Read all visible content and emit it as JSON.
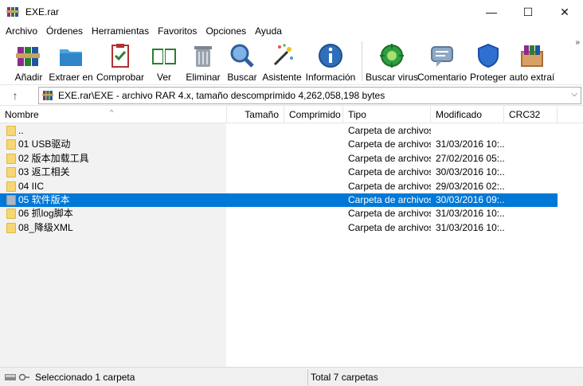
{
  "window": {
    "title": "EXE.rar",
    "minimize": "—",
    "maximize": "☐",
    "close": "✕"
  },
  "menu": [
    "Archivo",
    "Órdenes",
    "Herramientas",
    "Favoritos",
    "Opciones",
    "Ayuda"
  ],
  "toolbar": [
    {
      "label": "Añadir",
      "icon": "books-add-icon"
    },
    {
      "label": "Extraer en",
      "icon": "folder-extract-icon"
    },
    {
      "label": "Comprobar",
      "icon": "clipboard-check-icon"
    },
    {
      "label": "Ver",
      "icon": "open-book-icon"
    },
    {
      "label": "Eliminar",
      "icon": "trash-icon"
    },
    {
      "label": "Buscar",
      "icon": "magnifier-icon"
    },
    {
      "label": "Asistente",
      "icon": "wand-icon"
    },
    {
      "label": "Información",
      "icon": "info-icon"
    },
    {
      "label": "Buscar virus",
      "icon": "virus-icon"
    },
    {
      "label": "Comentario",
      "icon": "comment-icon"
    },
    {
      "label": "Proteger",
      "icon": "shield-icon"
    },
    {
      "label": "auto extraí",
      "icon": "sfx-box-icon"
    }
  ],
  "toolbar_overflow": "»",
  "address": {
    "text": "EXE.rar\\EXE - archivo RAR 4.x, tamaño descomprimido 4,262,058,198 bytes",
    "up": "↑",
    "dropdown": "⌵"
  },
  "columns": [
    "Nombre",
    "Tamaño",
    "Comprimido",
    "Tipo",
    "Modificado",
    "CRC32"
  ],
  "rows": [
    {
      "name": "..",
      "size": "",
      "packed": "",
      "type": "Carpeta de archivos",
      "modified": "",
      "crc": ""
    },
    {
      "name": "01 USB驱动",
      "size": "",
      "packed": "",
      "type": "Carpeta de archivos",
      "modified": "31/03/2016 10:...",
      "crc": ""
    },
    {
      "name": "02 版本加载工具",
      "size": "",
      "packed": "",
      "type": "Carpeta de archivos",
      "modified": "27/02/2016 05:...",
      "crc": ""
    },
    {
      "name": "03 返工相关",
      "size": "",
      "packed": "",
      "type": "Carpeta de archivos",
      "modified": "30/03/2016 10:...",
      "crc": ""
    },
    {
      "name": "04 IIC",
      "size": "",
      "packed": "",
      "type": "Carpeta de archivos",
      "modified": "29/03/2016 02:...",
      "crc": ""
    },
    {
      "name": "05 软件版本",
      "size": "",
      "packed": "",
      "type": "Carpeta de archivos",
      "modified": "30/03/2016 09:...",
      "crc": "",
      "selected": true
    },
    {
      "name": "06 抓log脚本",
      "size": "",
      "packed": "",
      "type": "Carpeta de archivos",
      "modified": "31/03/2016 10:...",
      "crc": ""
    },
    {
      "name": "08_降级XML",
      "size": "",
      "packed": "",
      "type": "Carpeta de archivos",
      "modified": "31/03/2016 10:...",
      "crc": ""
    }
  ],
  "status": {
    "left": "Seleccionado 1 carpeta",
    "right": "Total 7 carpetas"
  }
}
